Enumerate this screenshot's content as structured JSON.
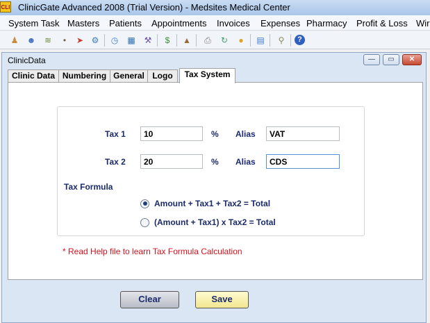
{
  "window": {
    "title": "ClinicGate Advanced 2008 (Trial Version) - Medsites Medical Center",
    "icon_text": "CLI"
  },
  "menu": [
    "System Task",
    "Masters",
    "Patients",
    "Appointments",
    "Invoices",
    "Expenses",
    "Pharmacy",
    "Profit & Loss",
    "Wir"
  ],
  "toolbar": {
    "icons": [
      "users-icon",
      "user-icon",
      "chart-icon",
      "syringe-icon",
      "medicine-icon",
      "settings-icon",
      "clock-icon",
      "calendar-icon",
      "tool-icon",
      "money-icon",
      "bottle-icon",
      "printer-icon",
      "refresh-icon",
      "chat-icon",
      "document-icon",
      "key-icon",
      "help-icon"
    ],
    "colors": [
      "#c98a3a",
      "#3f6fbf",
      "#6a8c3a",
      "#7a5a3a",
      "#c63b2b",
      "#3a7abf",
      "#3f7fc9",
      "#2f6faf",
      "#6a4fa3",
      "#3b8f3a",
      "#9a6a3a",
      "#7a7a7a",
      "#3f9f6f",
      "#e0a020",
      "#3a7ac9",
      "#8a8a5a",
      "#2f5fbf"
    ]
  },
  "inner_window": {
    "title": "ClinicData",
    "buttons": {
      "minimize": "—",
      "restore": "▭",
      "close": "✕"
    }
  },
  "tabs": [
    "Clinic Data",
    "Numbering",
    "General",
    "Logo",
    "Tax System"
  ],
  "active_tab": "Tax System",
  "form": {
    "tax1_label": "Tax 1",
    "tax1_value": "10",
    "tax2_label": "Tax 2",
    "tax2_value": "20",
    "percent": "%",
    "alias_label": "Alias",
    "alias1_value": "VAT",
    "alias2_value": "CDS",
    "formula_label": "Tax Formula",
    "option1": "Amount + Tax1 + Tax2 = Total",
    "option2": "(Amount + Tax1) x Tax2 = Total",
    "note": "* Read Help file to learn Tax Formula Calculation"
  },
  "buttons": {
    "clear": "Clear",
    "save": "Save"
  }
}
